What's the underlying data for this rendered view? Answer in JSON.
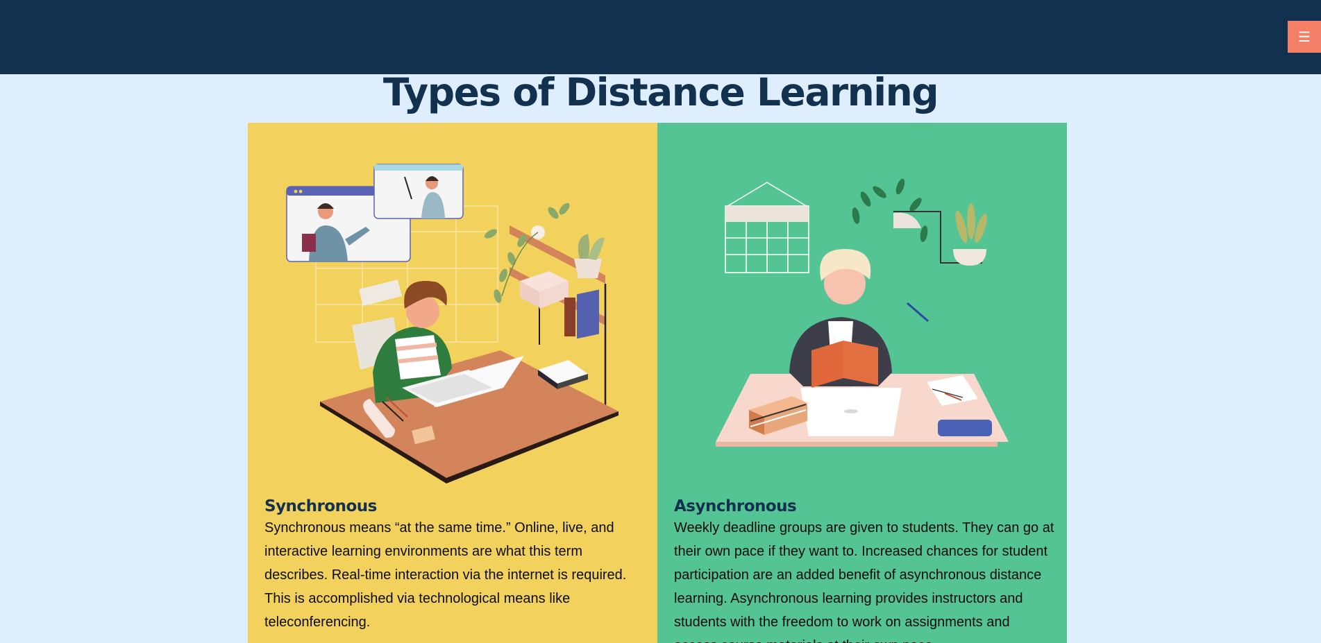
{
  "header": {
    "menu_icon": "☰",
    "menu_color": "#f47f66",
    "bg_color": "#12314e"
  },
  "page": {
    "title": "Types of Distance Learning"
  },
  "cards": [
    {
      "title": "Synchronous",
      "text": "Synchronous means “at the same time.” Online, live, and interactive learning environments are what this term describes. Real-time interaction via the internet is required. This is accomplished via technological means like teleconferencing.",
      "bg_color": "#f2d25c",
      "illustration": "student-laptop-video-call-illustration"
    },
    {
      "title": "Asynchronous",
      "text": "Weekly deadline groups are given to students. They can go at their own pace if they want to. Increased chances for student participation are an added benefit of asynchronous distance learning. Asynchronous learning provides instructors and students with the freedom to work on assignments and access course materials at their own pace.",
      "bg_color": "#55c495",
      "illustration": "student-reading-book-illustration"
    }
  ]
}
